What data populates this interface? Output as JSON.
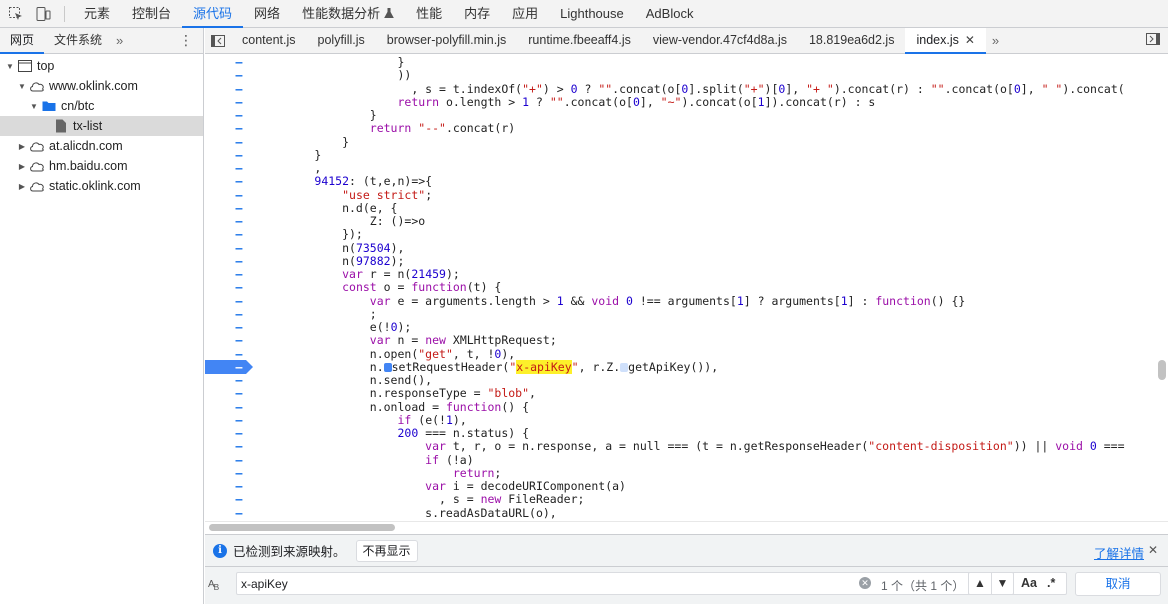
{
  "toolbar": {
    "tabs": [
      {
        "label": "元素"
      },
      {
        "label": "控制台"
      },
      {
        "label": "源代码",
        "active": true
      },
      {
        "label": "网络"
      },
      {
        "label": "性能数据分析",
        "icon": "flask-icon"
      },
      {
        "label": "性能"
      },
      {
        "label": "内存"
      },
      {
        "label": "应用"
      },
      {
        "label": "Lighthouse"
      },
      {
        "label": "AdBlock"
      }
    ]
  },
  "sidebar": {
    "tabs": [
      {
        "label": "网页",
        "active": true
      },
      {
        "label": "文件系统"
      }
    ],
    "tree": [
      {
        "label": "top",
        "icon": "frame-icon"
      },
      {
        "label": "www.oklink.com",
        "icon": "cloud-icon"
      },
      {
        "label": "cn/btc",
        "icon": "folder-icon"
      },
      {
        "label": "tx-list",
        "icon": "file-icon",
        "selected": true
      },
      {
        "label": "at.alicdn.com",
        "icon": "cloud-icon"
      },
      {
        "label": "hm.baidu.com",
        "icon": "cloud-icon"
      },
      {
        "label": "static.oklink.com",
        "icon": "cloud-icon"
      }
    ]
  },
  "editor": {
    "tabs": [
      {
        "label": "content.js"
      },
      {
        "label": "polyfill.js"
      },
      {
        "label": "browser-polyfill.min.js"
      },
      {
        "label": "runtime.fbeeaff4.js"
      },
      {
        "label": "view-vendor.47cf4d8a.js"
      },
      {
        "label": "18.819ea6d2.js"
      },
      {
        "label": "index.js",
        "active": true
      }
    ],
    "breakpoint_line": 23,
    "gutter_marker": "–",
    "lines": [
      "                    }",
      "                    ))",
      "                      , s = t.indexOf(\"+\") > 0 ? \"\".concat(o[0].split(\"+\")[0], \"+ \").concat(r) : \"\".concat(o[0], \" \").concat(",
      "                    return o.length > 1 ? \"\".concat(o[0], \"~\").concat(o[1]).concat(r) : s",
      "                }",
      "                return \"--\".concat(r)",
      "            }",
      "        }",
      "        ,",
      "        94152: (t,e,n)=>{",
      "            \"use strict\";",
      "            n.d(e, {",
      "                Z: ()=>o",
      "            });",
      "            n(73504),",
      "            n(97882);",
      "            var r = n(21459);",
      "            const o = function(t) {",
      "                var e = arguments.length > 1 && void 0 !== arguments[1] ? arguments[1] : function() {}",
      "                ;",
      "                e(!0);",
      "                var n = new XMLHttpRequest;",
      "                n.open(\"get\", t, !0),",
      "                n.●setRequestHeader(\"x-apiKey\", r.Z.○getApiKey()),",
      "                n.send(),",
      "                n.responseType = \"blob\",",
      "                n.onload = function() {",
      "                    if (e(!1),",
      "                    200 === n.status) {",
      "                        var t, r, o = n.response, a = null === (t = n.getResponseHeader(\"content-disposition\")) || void 0 ===",
      "                        if (!a)",
      "                            return;",
      "                        var i = decodeURIComponent(a)",
      "                          , s = new FileReader;",
      "                        s.readAsDataURL(o),"
    ]
  },
  "info_bar": {
    "message": "已检测到来源映射。",
    "dismiss_button": "不再显示",
    "learn_more": "了解详情"
  },
  "search": {
    "query": "x-apiKey",
    "match_count": "1 个（共 1 个）",
    "case_label": "Aa",
    "regex_label": ".*",
    "cancel": "取消"
  },
  "colors": {
    "accent": "#1a73e8",
    "breakpoint": "#4285f4",
    "highlight": "#fdf02a",
    "keyword": "#9b0fa8",
    "string": "#c41a16",
    "number": "#1c00cf"
  }
}
